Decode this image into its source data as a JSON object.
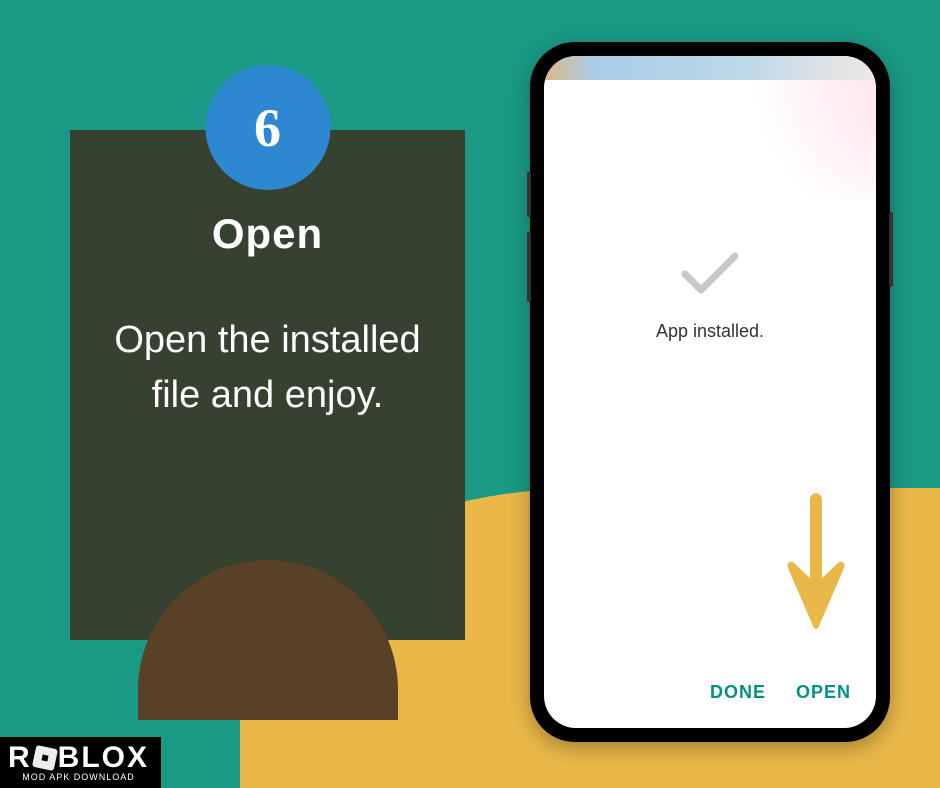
{
  "step": {
    "number": "6",
    "title": "Open",
    "description": "Open the installed file and enjoy."
  },
  "phone": {
    "status_text": "App installed.",
    "done_label": "DONE",
    "open_label": "OPEN"
  },
  "logo": {
    "main_left": "R",
    "main_right": "BLOX",
    "sub": "MOD APK DOWNLOAD"
  }
}
